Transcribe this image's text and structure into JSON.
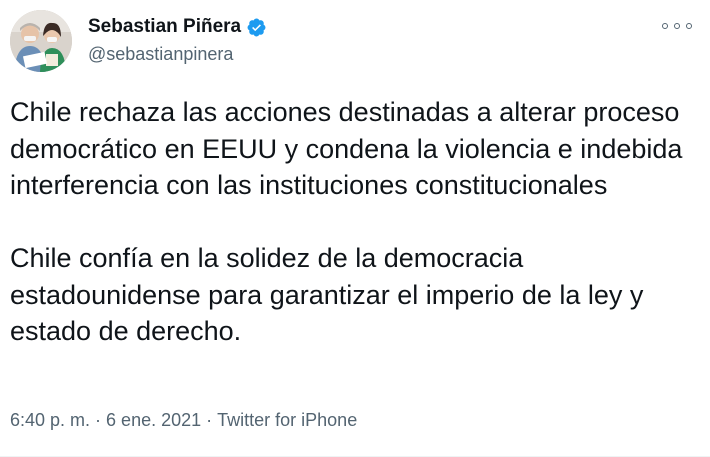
{
  "author": {
    "name": "Sebastian Piñera",
    "handle": "@sebastianpinera",
    "verified": true,
    "avatar_icon": "avatar-photo"
  },
  "more_icon": "more-horizontal-icon",
  "tweet": {
    "paragraphs": [
      "Chile rechaza las acciones destinadas a alterar proceso democrático en EEUU y condena la violencia e indebida interferencia con las instituciones constitucionales",
      "Chile confía en la solidez de la democracia estadounidense para garantizar el imperio de la ley y estado de derecho."
    ]
  },
  "meta": {
    "time": "6:40 p. m.",
    "separator": "·",
    "date": "6 ene. 2021",
    "source": "Twitter for iPhone"
  },
  "colors": {
    "text": "#0f1419",
    "secondary": "#536471",
    "verified": "#1d9bf0"
  }
}
